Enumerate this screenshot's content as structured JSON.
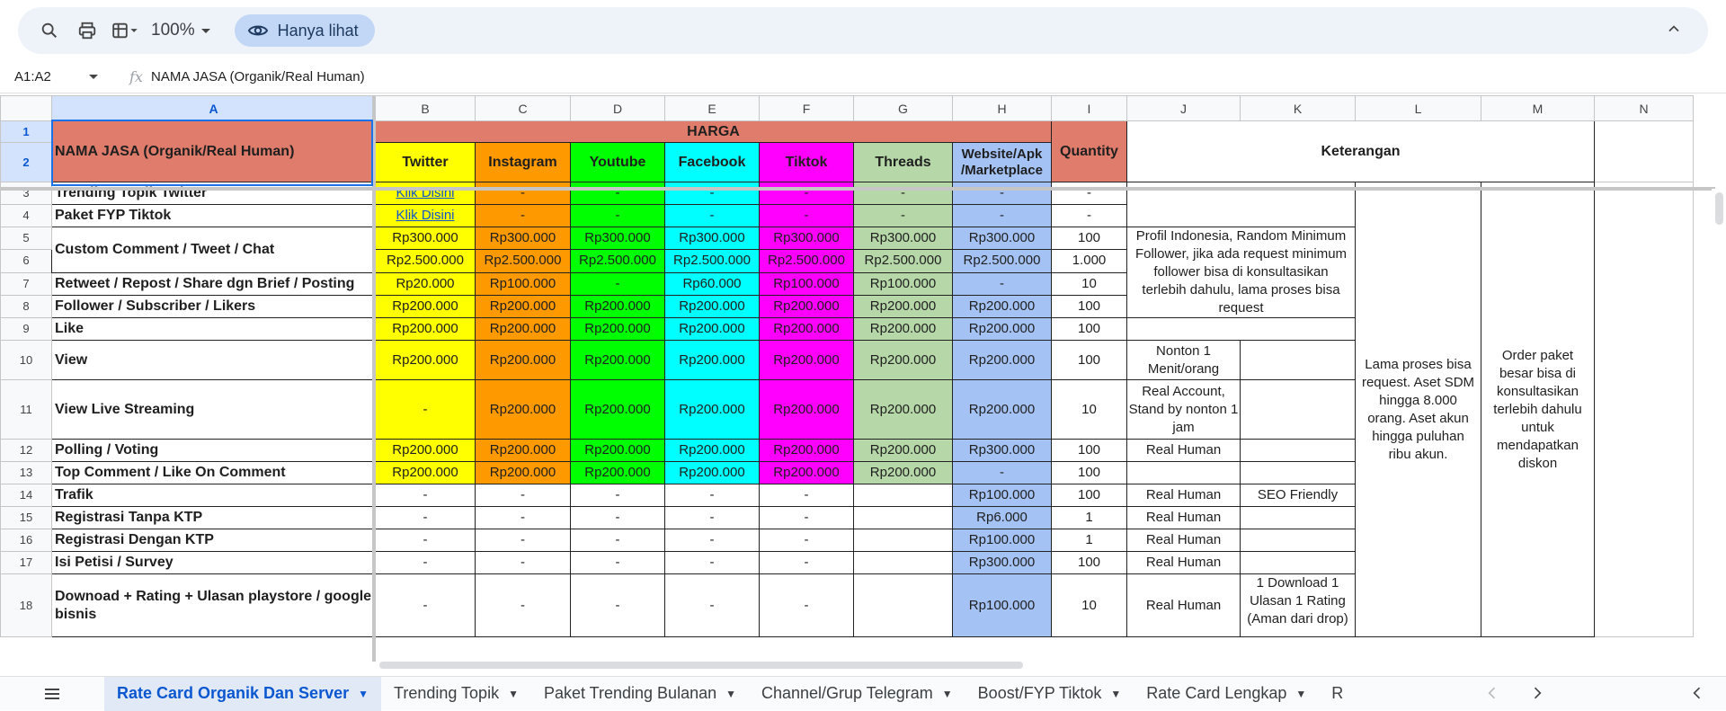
{
  "toolbar": {
    "zoom": "100%",
    "view_only_label": "Hanya lihat"
  },
  "formula_bar": {
    "cell_ref": "A1:A2",
    "content": "NAMA JASA (Organik/Real Human)"
  },
  "columns": [
    "A",
    "B",
    "C",
    "D",
    "E",
    "F",
    "G",
    "H",
    "I",
    "J",
    "K",
    "L",
    "M",
    "N"
  ],
  "rows": [
    "1",
    "2",
    "3",
    "4",
    "5",
    "6",
    "7",
    "8",
    "9",
    "10",
    "11",
    "12",
    "13",
    "14",
    "15",
    "16",
    "17",
    "18"
  ],
  "header": {
    "nama_jasa": "NAMA JASA (Organik/Real Human)",
    "harga": "HARGA",
    "quantity": "Quantity",
    "keterangan": "Keterangan",
    "platforms": [
      "Twitter",
      "Instagram",
      "Youtube",
      "Facebook",
      "Tiktok",
      "Threads",
      "Website/Apk /Marketplace"
    ]
  },
  "services": [
    {
      "name": "Trending Topik Twitter",
      "prices": [
        "Klik Disini",
        "-",
        "-",
        "-",
        "-",
        "-",
        "-"
      ],
      "qty": "-"
    },
    {
      "name": "Paket FYP Tiktok",
      "prices": [
        "Klik Disini",
        "-",
        "-",
        "-",
        "-",
        "-",
        "-"
      ],
      "qty": "-"
    },
    {
      "name": "Custom Comment / Tweet / Chat",
      "prices": [
        "Rp300.000",
        "Rp300.000",
        "Rp300.000",
        "Rp300.000",
        "Rp300.000",
        "Rp300.000",
        "Rp300.000"
      ],
      "qty": "100"
    },
    {
      "name": "",
      "prices": [
        "Rp2.500.000",
        "Rp2.500.000",
        "Rp2.500.000",
        "Rp2.500.000",
        "Rp2.500.000",
        "Rp2.500.000",
        "Rp2.500.000"
      ],
      "qty": "1.000"
    },
    {
      "name": "Retweet / Repost / Share dgn Brief / Posting",
      "prices": [
        "Rp20.000",
        "Rp100.000",
        "-",
        "Rp60.000",
        "Rp100.000",
        "Rp100.000",
        "-"
      ],
      "qty": "10"
    },
    {
      "name": "Follower / Subscriber / Likers",
      "prices": [
        "Rp200.000",
        "Rp200.000",
        "Rp200.000",
        "Rp200.000",
        "Rp200.000",
        "Rp200.000",
        "Rp200.000"
      ],
      "qty": "100"
    },
    {
      "name": "Like",
      "prices": [
        "Rp200.000",
        "Rp200.000",
        "Rp200.000",
        "Rp200.000",
        "Rp200.000",
        "Rp200.000",
        "Rp200.000"
      ],
      "qty": "100"
    },
    {
      "name": "View",
      "prices": [
        "Rp200.000",
        "Rp200.000",
        "Rp200.000",
        "Rp200.000",
        "Rp200.000",
        "Rp200.000",
        "Rp200.000"
      ],
      "qty": "100"
    },
    {
      "name": "View Live Streaming",
      "prices": [
        "-",
        "Rp200.000",
        "Rp200.000",
        "Rp200.000",
        "Rp200.000",
        "Rp200.000",
        "Rp200.000"
      ],
      "qty": "10"
    },
    {
      "name": "Polling / Voting",
      "prices": [
        "Rp200.000",
        "Rp200.000",
        "Rp200.000",
        "Rp200.000",
        "Rp200.000",
        "Rp200.000",
        "Rp300.000"
      ],
      "qty": "100"
    },
    {
      "name": "Top Comment / Like On Comment",
      "prices": [
        "Rp200.000",
        "Rp200.000",
        "Rp200.000",
        "Rp200.000",
        "Rp200.000",
        "Rp200.000",
        "-"
      ],
      "qty": "100"
    },
    {
      "name": "Trafik",
      "prices": [
        "-",
        "-",
        "-",
        "-",
        "-",
        "",
        "Rp100.000"
      ],
      "qty": "100"
    },
    {
      "name": "Registrasi Tanpa KTP",
      "prices": [
        "-",
        "-",
        "-",
        "-",
        "-",
        "",
        "Rp6.000"
      ],
      "qty": "1"
    },
    {
      "name": "Registrasi Dengan KTP",
      "prices": [
        "-",
        "-",
        "-",
        "-",
        "-",
        "",
        "Rp100.000"
      ],
      "qty": "1"
    },
    {
      "name": "Isi Petisi / Survey",
      "prices": [
        "-",
        "-",
        "-",
        "-",
        "-",
        "",
        "Rp300.000"
      ],
      "qty": "100"
    },
    {
      "name": "Downoad + Rating + Ulasan playstore / google bisnis",
      "prices": [
        "-",
        "-",
        "-",
        "-",
        "-",
        "",
        "Rp100.000"
      ],
      "qty": "10"
    }
  ],
  "notes": {
    "profil": "Profil Indonesia, Random Minimum Follower, jika ada request minimum follower bisa di konsultasikan terlebih dahulu, lama proses bisa request",
    "view_j": "Nonton 1 Menit/orang",
    "live_j": "Real Account, Stand by nonton 1 jam",
    "real_human": "Real Human",
    "seo": "SEO Friendly",
    "download_k": "1 Download 1 Ulasan 1 Rating (Aman dari drop)",
    "lama_proses": "Lama proses bisa request. Aset SDM hingga 8.000 orang. Aset akun hingga puluhan ribu akun.",
    "order_paket": "Order paket besar bisa di konsultasikan terlebih dahulu untuk mendapatkan diskon"
  },
  "sheet_tabs": [
    "Rate Card Organik Dan Server",
    "Trending Topik",
    "Paket Trending Bulanan",
    "Channel/Grup Telegram",
    "Boost/FYP Tiktok",
    "Rate Card Lengkap",
    "R"
  ],
  "icons": [
    "search-icon",
    "print-icon",
    "table-format-icon",
    "eye-icon",
    "chevron-up-icon",
    "function-icon",
    "menu-icon",
    "chevron-left-icon",
    "chevron-right-icon"
  ]
}
